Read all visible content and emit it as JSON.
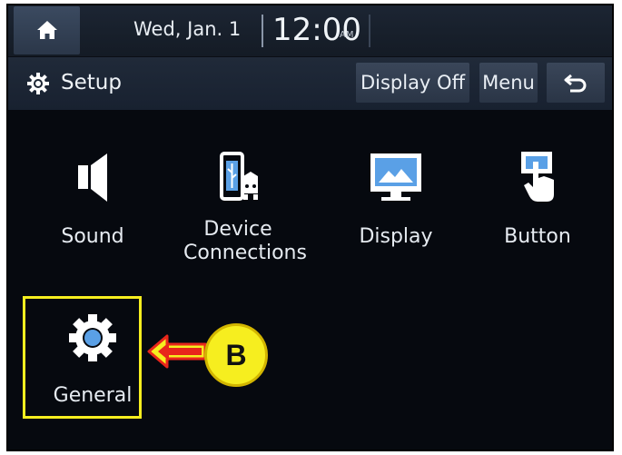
{
  "status": {
    "date": "Wed, Jan. 1",
    "time": "12:00",
    "ampm": "AM"
  },
  "header": {
    "title": "Setup",
    "display_off_label": "Display Off",
    "menu_label": "Menu"
  },
  "tiles": [
    {
      "label": "Sound",
      "icon": "speaker-icon"
    },
    {
      "label": "Device\nConnections",
      "icon": "phone-car-icon"
    },
    {
      "label": "Display",
      "icon": "monitor-icon"
    },
    {
      "label": "Button",
      "icon": "touch-button-icon"
    },
    {
      "label": "General",
      "icon": "gear-icon"
    }
  ],
  "annotation": {
    "callout_label": "B"
  },
  "colors": {
    "highlight": "#f6ee1f",
    "arrow": "#e8261b",
    "accent_blue": "#5aa0e6"
  }
}
